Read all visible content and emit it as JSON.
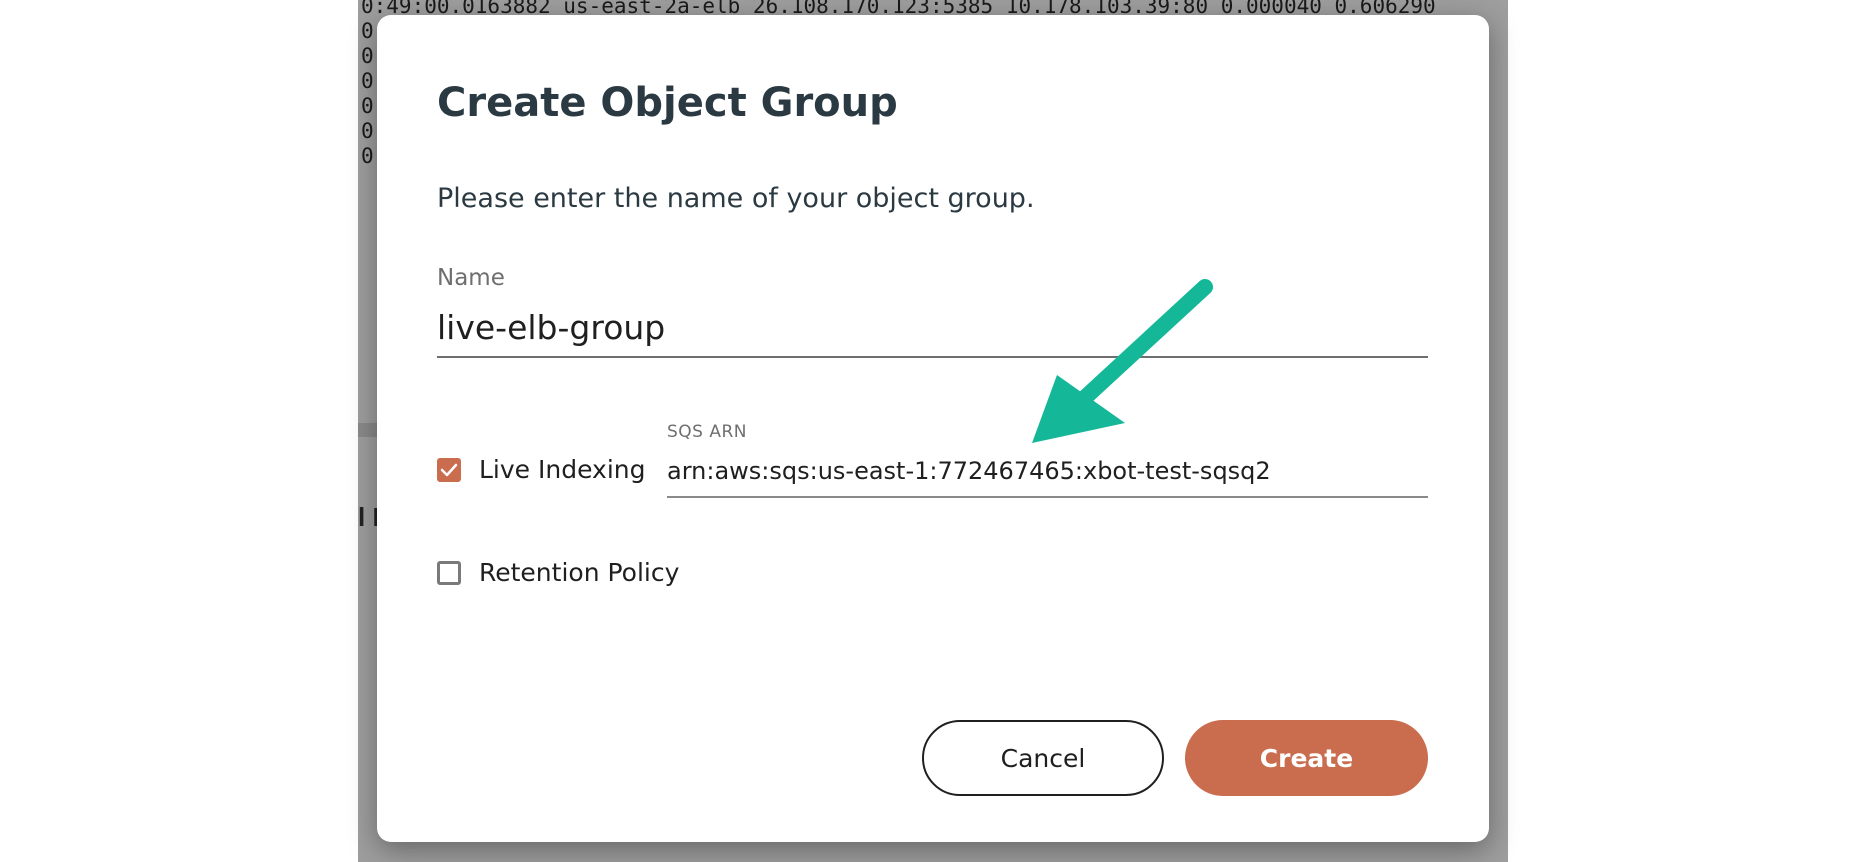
{
  "background": {
    "log_lines": [
      "0:49:00.0163882 us-east-2a-elb 26.108.170.123:5385 10.178.103.39:80 0.000040 0.606290",
      "0",
      "0",
      "0",
      "0",
      "0",
      "0"
    ],
    "heading_fragment": "l I"
  },
  "dialog": {
    "title": "Create Object Group",
    "description": "Please enter the name of your object group.",
    "name_label": "Name",
    "name_value": "live-elb-group",
    "live_indexing": {
      "label": "Live Indexing",
      "checked": true
    },
    "sqs_arn": {
      "label": "SQS ARN",
      "value": "arn:aws:sqs:us-east-1:772467465:xbot-test-sqsq2"
    },
    "retention_policy": {
      "label": "Retention Policy",
      "checked": false
    },
    "buttons": {
      "cancel": "Cancel",
      "create": "Create"
    }
  },
  "annotation": {
    "arrow_icon": "arrow-pointing-down-left-icon",
    "arrow_color": "#14b898"
  },
  "colors": {
    "accent": "#c96d4e",
    "title_text": "#2b3a42",
    "overlay": "#9e9e9e"
  }
}
